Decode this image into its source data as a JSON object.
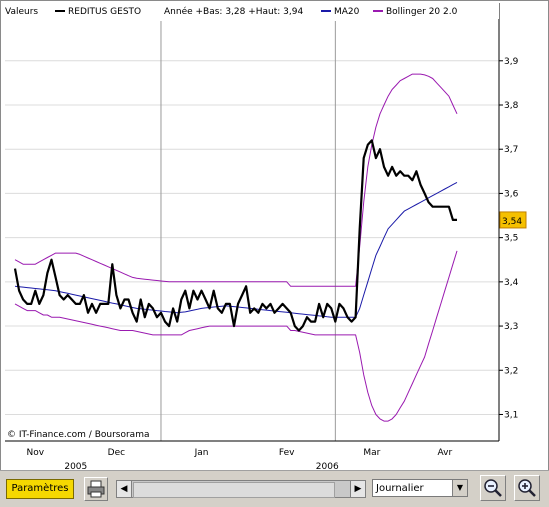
{
  "legend": {
    "valeurs": "Valeurs",
    "series_name": "REDITUS GESTO",
    "stats": "Année +Bas: 3,28 +Haut: 3,94",
    "ma_name": "MA20",
    "boll_name": "Bollinger 20 2.0"
  },
  "copyright": "© IT-Finance.com / Boursorama",
  "last_price": "3,54",
  "colors": {
    "price": "#000000",
    "ma": "#1a1aa8",
    "bollinger": "#9a1ab0",
    "badge": "#f5c000",
    "grid": "#dcdcdc",
    "divider": "#9a9a9a"
  },
  "toolbar": {
    "parametres": "Paramètres",
    "period": "Journalier",
    "print_icon": "printer-icon",
    "zoom_out_icon": "zoom-out-icon",
    "zoom_in_icon": "zoom-in-icon",
    "scroll_left": "◀",
    "scroll_right": "▶"
  },
  "chart_data": {
    "type": "line",
    "ylim": [
      3.04,
      3.99
    ],
    "yticks": [
      "3,1",
      "3,2",
      "3,3",
      "3,4",
      "3,5",
      "3,6",
      "3,7",
      "3,8",
      "3,9"
    ],
    "ytick_values": [
      3.1,
      3.2,
      3.3,
      3.4,
      3.5,
      3.6,
      3.7,
      3.8,
      3.9
    ],
    "x_months": [
      "Nov",
      "Dec",
      "Jan",
      "Fev",
      "Mar",
      "Avr"
    ],
    "x_years": [
      "2005",
      "2006"
    ],
    "x_count": 110,
    "month_idx": [
      5,
      25,
      46,
      67,
      88,
      106
    ],
    "year_idx": [
      15,
      77
    ],
    "divider_idx": [
      36,
      79
    ],
    "series": [
      {
        "name": "REDITUS GESTO",
        "values": [
          3.43,
          3.38,
          3.36,
          3.35,
          3.35,
          3.38,
          3.35,
          3.37,
          3.42,
          3.45,
          3.41,
          3.37,
          3.36,
          3.37,
          3.36,
          3.35,
          3.35,
          3.37,
          3.33,
          3.35,
          3.33,
          3.35,
          3.35,
          3.35,
          3.44,
          3.37,
          3.34,
          3.36,
          3.36,
          3.33,
          3.31,
          3.36,
          3.32,
          3.35,
          3.34,
          3.32,
          3.33,
          3.31,
          3.3,
          3.34,
          3.31,
          3.36,
          3.38,
          3.34,
          3.38,
          3.36,
          3.38,
          3.36,
          3.34,
          3.38,
          3.34,
          3.33,
          3.35,
          3.35,
          3.3,
          3.35,
          3.37,
          3.39,
          3.33,
          3.34,
          3.33,
          3.35,
          3.34,
          3.35,
          3.33,
          3.34,
          3.35,
          3.34,
          3.33,
          3.3,
          3.29,
          3.3,
          3.32,
          3.31,
          3.31,
          3.35,
          3.32,
          3.35,
          3.34,
          3.31,
          3.35,
          3.34,
          3.32,
          3.31,
          3.32,
          3.52,
          3.68,
          3.71,
          3.72,
          3.68,
          3.7,
          3.66,
          3.64,
          3.66,
          3.64,
          3.65,
          3.64,
          3.64,
          3.63,
          3.65,
          3.62,
          3.6,
          3.58,
          3.57,
          3.57,
          3.57,
          3.57,
          3.57,
          3.54,
          3.54
        ]
      },
      {
        "name": "MA20",
        "values": [
          3.39,
          3.389,
          3.388,
          3.387,
          3.386,
          3.385,
          3.384,
          3.383,
          3.382,
          3.381,
          3.38,
          3.378,
          3.376,
          3.374,
          3.372,
          3.37,
          3.368,
          3.366,
          3.364,
          3.362,
          3.36,
          3.358,
          3.356,
          3.354,
          3.352,
          3.35,
          3.348,
          3.346,
          3.344,
          3.342,
          3.34,
          3.339,
          3.338,
          3.337,
          3.336,
          3.335,
          3.334,
          3.333,
          3.332,
          3.331,
          3.33,
          3.331,
          3.332,
          3.334,
          3.336,
          3.338,
          3.34,
          3.341,
          3.342,
          3.343,
          3.344,
          3.345,
          3.346,
          3.345,
          3.344,
          3.343,
          3.342,
          3.341,
          3.34,
          3.339,
          3.338,
          3.337,
          3.336,
          3.335,
          3.334,
          3.333,
          3.332,
          3.331,
          3.33,
          3.329,
          3.328,
          3.327,
          3.326,
          3.325,
          3.324,
          3.323,
          3.322,
          3.321,
          3.32,
          3.32,
          3.32,
          3.32,
          3.32,
          3.32,
          3.32,
          3.34,
          3.37,
          3.4,
          3.43,
          3.46,
          3.48,
          3.5,
          3.52,
          3.53,
          3.54,
          3.55,
          3.56,
          3.565,
          3.57,
          3.575,
          3.58,
          3.585,
          3.59,
          3.595,
          3.6,
          3.605,
          3.61,
          3.615,
          3.62,
          3.625
        ]
      },
      {
        "name": "Bollinger upper",
        "values": [
          3.45,
          3.445,
          3.44,
          3.44,
          3.44,
          3.44,
          3.445,
          3.45,
          3.455,
          3.46,
          3.465,
          3.465,
          3.465,
          3.465,
          3.465,
          3.465,
          3.462,
          3.458,
          3.454,
          3.45,
          3.446,
          3.442,
          3.438,
          3.434,
          3.43,
          3.426,
          3.422,
          3.418,
          3.414,
          3.41,
          3.408,
          3.407,
          3.406,
          3.405,
          3.404,
          3.403,
          3.402,
          3.401,
          3.4,
          3.4,
          3.4,
          3.4,
          3.4,
          3.4,
          3.4,
          3.4,
          3.4,
          3.4,
          3.4,
          3.4,
          3.4,
          3.4,
          3.4,
          3.4,
          3.4,
          3.4,
          3.4,
          3.4,
          3.4,
          3.4,
          3.4,
          3.4,
          3.4,
          3.4,
          3.4,
          3.4,
          3.4,
          3.4,
          3.39,
          3.39,
          3.39,
          3.39,
          3.39,
          3.39,
          3.39,
          3.39,
          3.39,
          3.39,
          3.39,
          3.39,
          3.39,
          3.39,
          3.39,
          3.39,
          3.39,
          3.48,
          3.58,
          3.66,
          3.71,
          3.75,
          3.78,
          3.8,
          3.82,
          3.835,
          3.845,
          3.855,
          3.86,
          3.865,
          3.87,
          3.87,
          3.87,
          3.868,
          3.865,
          3.86,
          3.85,
          3.84,
          3.83,
          3.82,
          3.8,
          3.78
        ]
      },
      {
        "name": "Bollinger lower",
        "values": [
          3.35,
          3.345,
          3.34,
          3.335,
          3.335,
          3.335,
          3.33,
          3.325,
          3.325,
          3.32,
          3.32,
          3.32,
          3.318,
          3.316,
          3.314,
          3.312,
          3.31,
          3.308,
          3.306,
          3.304,
          3.302,
          3.3,
          3.298,
          3.296,
          3.294,
          3.292,
          3.29,
          3.29,
          3.29,
          3.29,
          3.288,
          3.286,
          3.284,
          3.282,
          3.28,
          3.28,
          3.28,
          3.28,
          3.28,
          3.28,
          3.28,
          3.28,
          3.285,
          3.29,
          3.292,
          3.294,
          3.296,
          3.298,
          3.3,
          3.3,
          3.3,
          3.3,
          3.3,
          3.3,
          3.3,
          3.3,
          3.3,
          3.3,
          3.3,
          3.3,
          3.3,
          3.3,
          3.3,
          3.3,
          3.3,
          3.3,
          3.3,
          3.3,
          3.29,
          3.29,
          3.288,
          3.286,
          3.284,
          3.282,
          3.28,
          3.28,
          3.28,
          3.28,
          3.28,
          3.28,
          3.28,
          3.28,
          3.28,
          3.28,
          3.28,
          3.24,
          3.19,
          3.15,
          3.12,
          3.1,
          3.09,
          3.085,
          3.085,
          3.09,
          3.1,
          3.115,
          3.13,
          3.15,
          3.17,
          3.19,
          3.21,
          3.23,
          3.26,
          3.29,
          3.32,
          3.35,
          3.38,
          3.41,
          3.44,
          3.47
        ]
      }
    ],
    "grid": true,
    "legend_position": "top"
  }
}
